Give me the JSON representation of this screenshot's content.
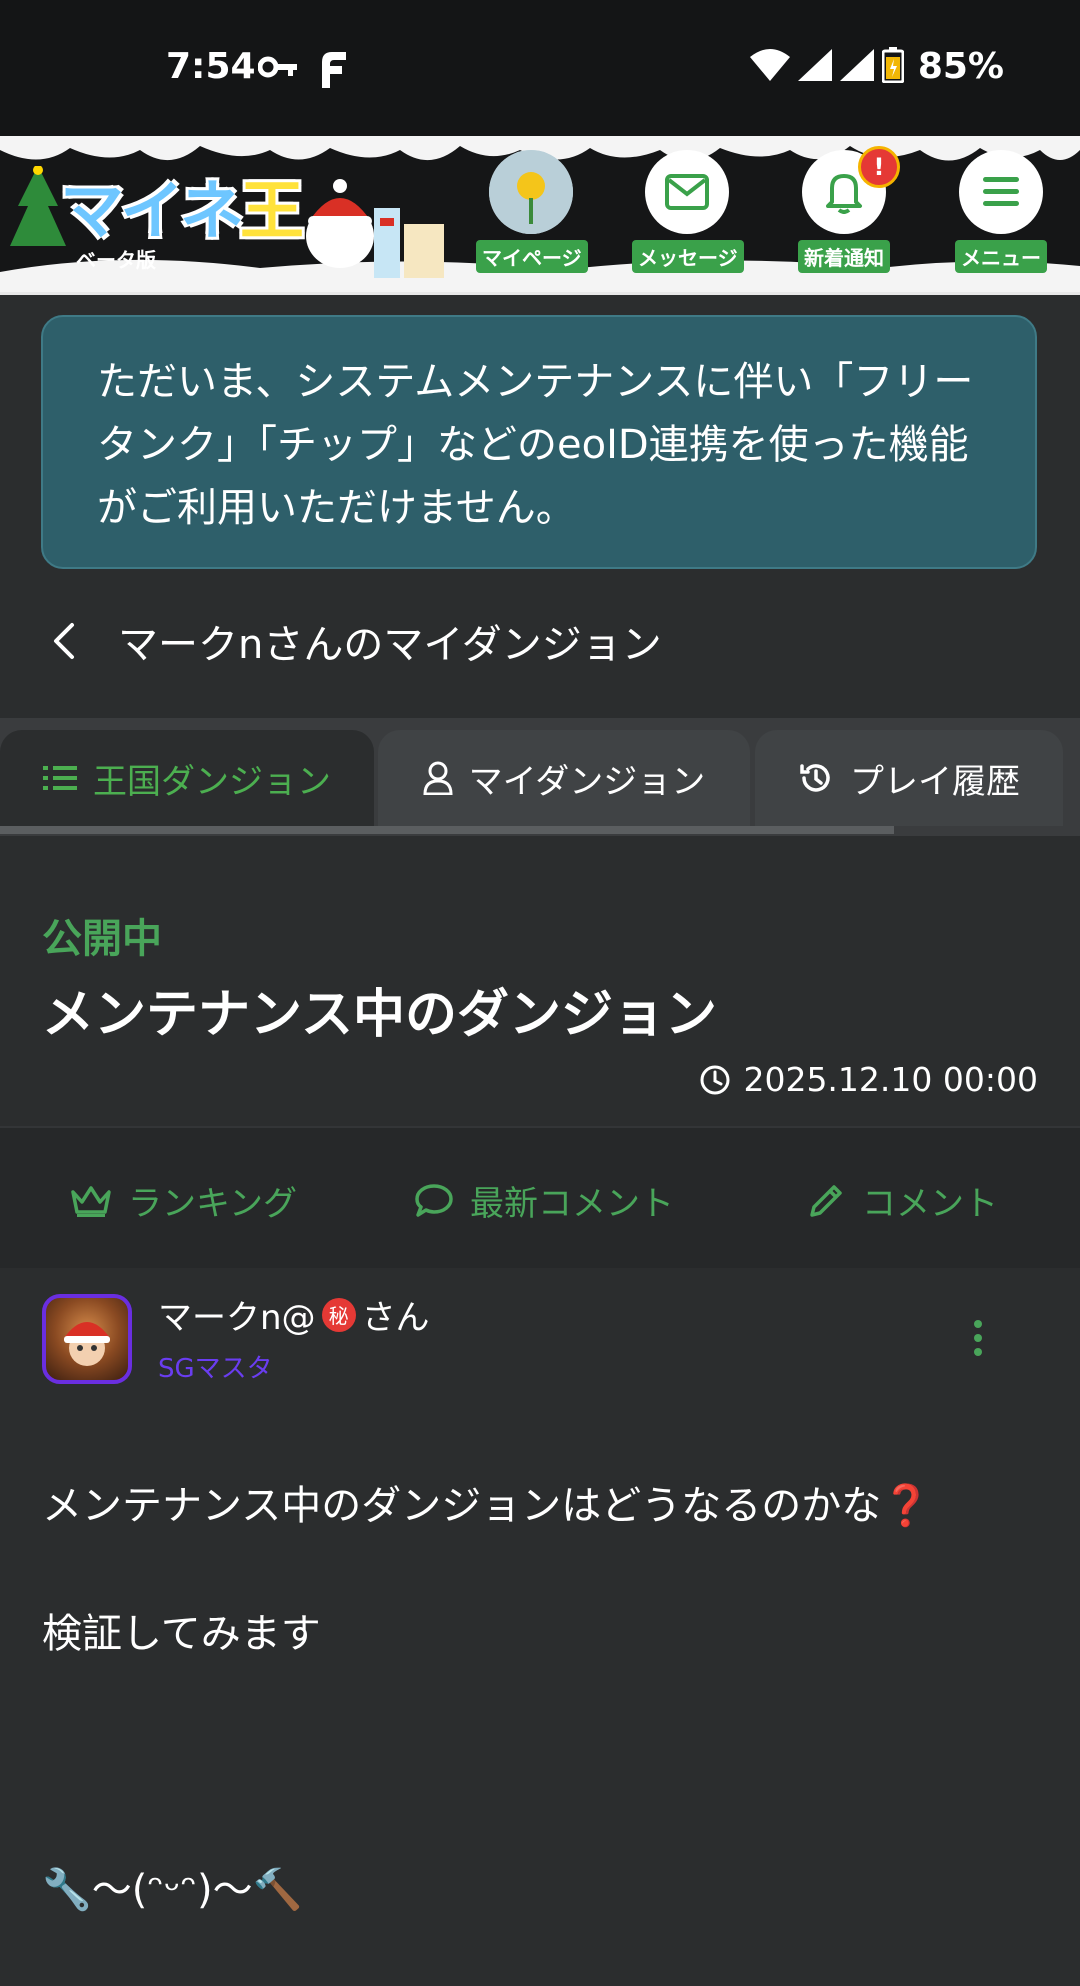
{
  "status_bar": {
    "time": "7:54",
    "battery": "85%"
  },
  "header": {
    "logo": "マイネ王",
    "beta_label": "ベータ版",
    "nav": [
      {
        "label": "マイページ",
        "icon": "avatar-flower-icon"
      },
      {
        "label": "メッセージ",
        "icon": "envelope-icon"
      },
      {
        "label": "新着通知",
        "icon": "bell-icon",
        "badge": "!"
      },
      {
        "label": "メニュー",
        "icon": "hamburger-icon"
      }
    ]
  },
  "notice": {
    "text": "ただいま、システムメンテナンスに伴い「フリータンク」「チップ」などのeoID連携を使った機能がご利用いただけません。"
  },
  "back": {
    "label": "マークnさんのマイダンジョン"
  },
  "tabs": [
    {
      "label": "王国ダンジョン",
      "icon": "list-icon",
      "active": true
    },
    {
      "label": "マイダンジョン",
      "icon": "user-icon",
      "active": false
    },
    {
      "label": "プレイ履歴",
      "icon": "history-icon",
      "active": false
    }
  ],
  "dungeon": {
    "status": "公開中",
    "title": "メンテナンス中のダンジョン",
    "date": "2025.12.10 00:00"
  },
  "actions": [
    {
      "label": "ランキング",
      "icon": "crown-icon"
    },
    {
      "label": "最新コメント",
      "icon": "speech-bubble-icon"
    },
    {
      "label": "コメント",
      "icon": "pencil-icon"
    }
  ],
  "comment": {
    "user_prefix": "マークn@",
    "secret_mark": "秘",
    "user_suffix": "さん",
    "rank": "SGマスタ",
    "body_line1": "メンテナンス中のダンジョンはどうなるのかな",
    "question_mark": "❓",
    "body_line2": "検証してみます",
    "body_line3": "🔧〜(ᵔᵕᵔ)〜🔨"
  },
  "colors": {
    "accent_green": "#49a55a",
    "notice_bg": "#2e5f6a",
    "rank_purple": "#6a3df0",
    "badge_red": "#e53935"
  }
}
